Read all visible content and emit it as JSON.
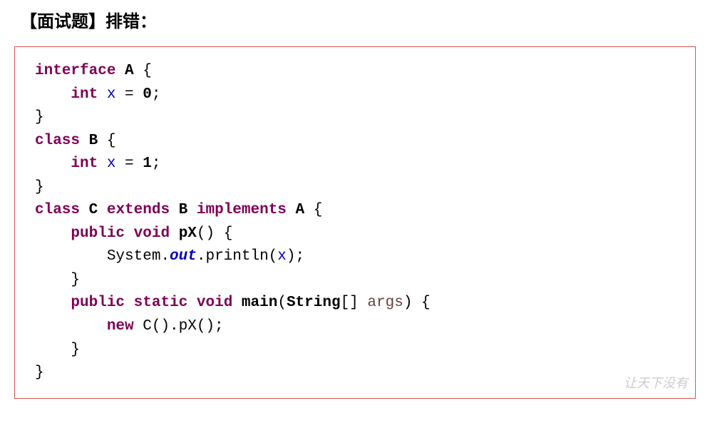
{
  "title": "【面试题】排错：",
  "code": {
    "l1_kw1": "interface",
    "l1_cls": "A",
    "l1_brace": " {",
    "l2_indent": "    ",
    "l2_kw": "int",
    "l2_var": "x",
    "l2_eq": " = ",
    "l2_val": "0",
    "l2_semi": ";",
    "l3": "}",
    "l4_kw": "class",
    "l4_cls": "B",
    "l4_brace": " {",
    "l5_indent": "    ",
    "l5_kw": "int",
    "l5_var": "x",
    "l5_eq": " = ",
    "l5_val": "1",
    "l5_semi": ";",
    "l6": "}",
    "l7_kw1": "class",
    "l7_cls1": "C",
    "l7_kw2": "extends",
    "l7_cls2": "B",
    "l7_kw3": "implements",
    "l7_cls3": "A",
    "l7_brace": " {",
    "l8_indent": "    ",
    "l8_kw1": "public",
    "l8_kw2": "void",
    "l8_method": "pX",
    "l8_paren": "() {",
    "l9_indent": "        ",
    "l9_sys": "System.",
    "l9_out": "out",
    "l9_dot": ".",
    "l9_println": "println(",
    "l9_arg": "x",
    "l9_close": ");",
    "l10_indent": "    ",
    "l10": "}",
    "l11_indent": "    ",
    "l11_kw1": "public",
    "l11_kw2": "static",
    "l11_kw3": "void",
    "l11_method": "main",
    "l11_paren1": "(",
    "l11_type": "String",
    "l11_arr": "[] ",
    "l11_param": "args",
    "l11_paren2": ") {",
    "l12_indent": "        ",
    "l12_kw": "new",
    "l12_text": " C().pX();",
    "l13_indent": "    ",
    "l13": "}",
    "l14": "}"
  },
  "watermark": "让天下没有"
}
